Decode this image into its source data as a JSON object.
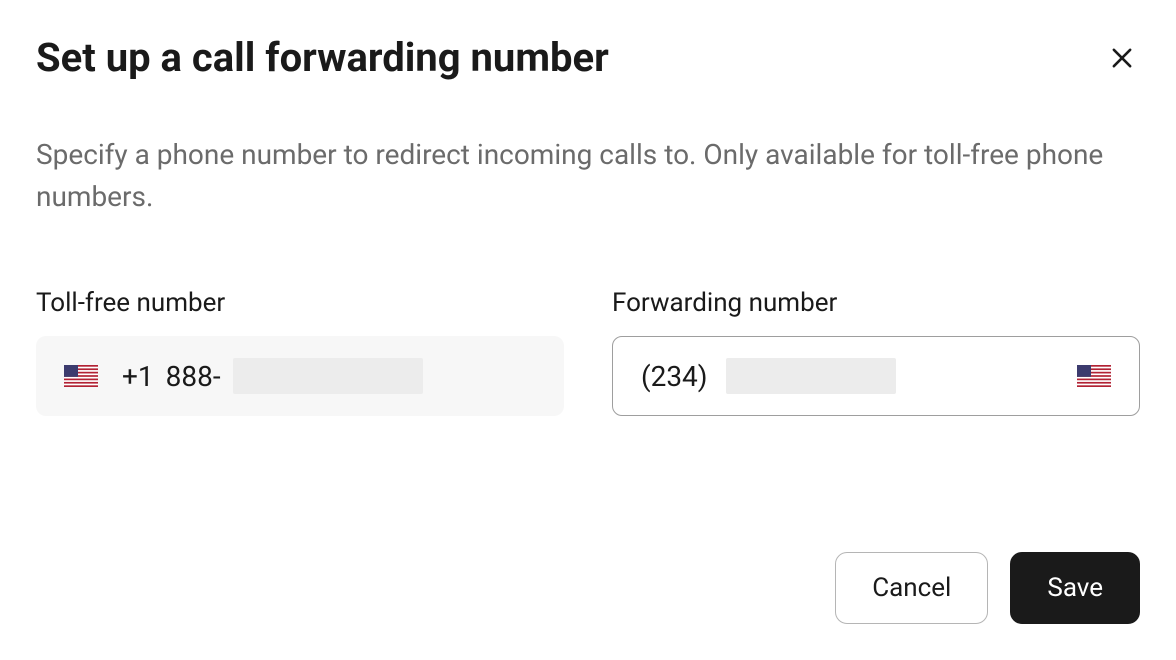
{
  "title": "Set up a call forwarding number",
  "description": "Specify a phone number to redirect incoming calls to. Only available for toll-free phone numbers.",
  "fields": {
    "tollfree": {
      "label": "Toll-free number",
      "prefix": "+1",
      "area": "888-",
      "rest_redacted": true
    },
    "forwarding": {
      "label": "Forwarding number",
      "prefix": "(234)",
      "rest_redacted": true
    }
  },
  "buttons": {
    "cancel": "Cancel",
    "save": "Save"
  },
  "icons": {
    "close": "close-icon",
    "flag": "us-flag-icon"
  }
}
